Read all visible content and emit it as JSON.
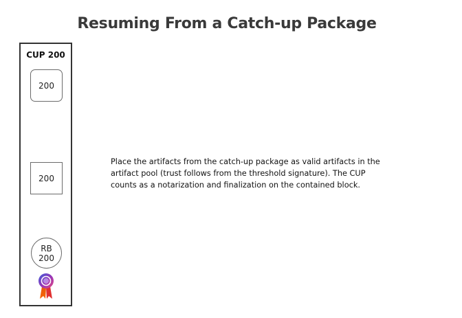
{
  "title": "Resuming From a Catch-up Package",
  "cup": {
    "label": "CUP 200",
    "block_rounded": "200",
    "block_square": "200",
    "random_beacon": {
      "line1": "RB",
      "line2": "200"
    },
    "badge_icon": "rosette-badge-icon"
  },
  "description": "Place the artifacts from the catch-up package as valid artifacts in the artifact pool (trust follows from the threshold signature). The CUP counts as a notarization and finalization on the contained block.",
  "colors": {
    "badge_gradient_start": "#3b5bdb",
    "badge_gradient_mid": "#c2255c",
    "badge_ribbon": "#f76707"
  }
}
